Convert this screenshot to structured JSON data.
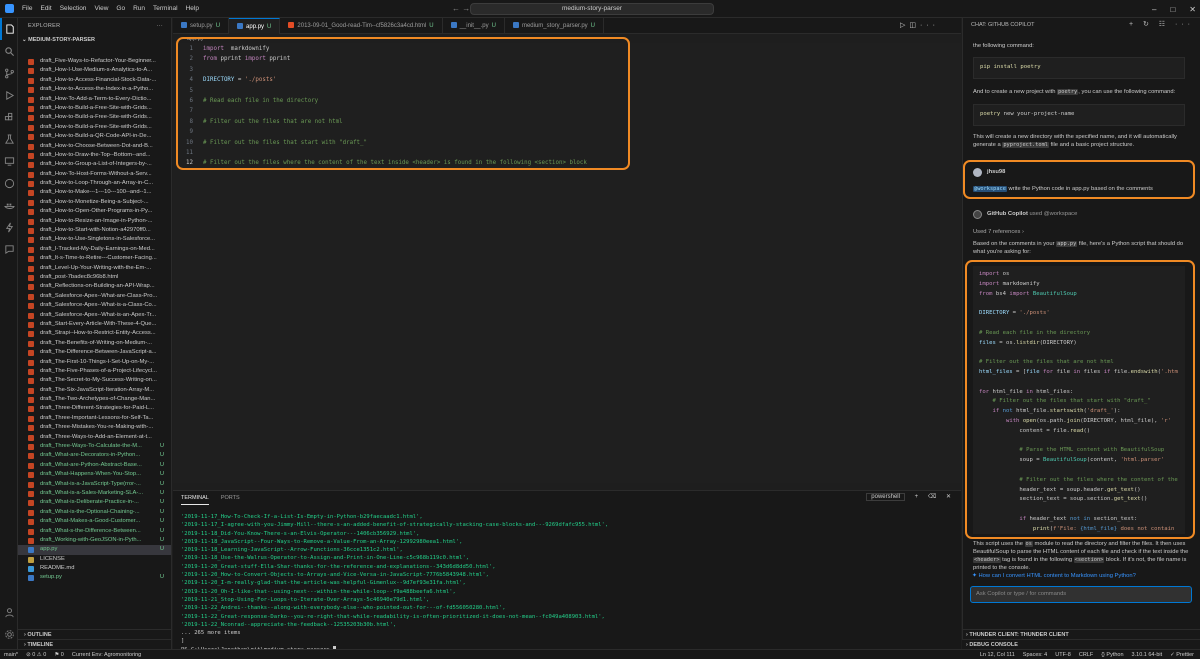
{
  "title_bar": {
    "menus": [
      "File",
      "Edit",
      "Selection",
      "View",
      "Go",
      "Run",
      "Terminal",
      "Help"
    ],
    "search_text": "medium-story-parser",
    "nav_arrows": "← →"
  },
  "explorer": {
    "header": "EXPLORER",
    "project": "MEDIUM-STORY-PARSER",
    "files": [
      {
        "name": "draft_Five-Ways-to-Refactor-Your-Beginner...",
        "status": "",
        "color": "normal"
      },
      {
        "name": "draft_How-I-Use-Medium-s-Analytics-to-A...",
        "status": "",
        "color": "normal"
      },
      {
        "name": "draft_How-to-Access-Financial-Stock-Data-...",
        "status": "",
        "color": "normal"
      },
      {
        "name": "draft_How-to-Access-the-Index-in-a-Pytho...",
        "status": "",
        "color": "normal"
      },
      {
        "name": "draft_How-To-Add-a-Term-to-Every-Dictio...",
        "status": "",
        "color": "normal"
      },
      {
        "name": "draft_How-to-Build-a-Free-Site-with-Grids...",
        "status": "",
        "color": "normal"
      },
      {
        "name": "draft_How-to-Build-a-Free-Site-with-Grids...",
        "status": "",
        "color": "normal"
      },
      {
        "name": "draft_How-to-Build-a-Free-Site-with-Grids...",
        "status": "",
        "color": "normal"
      },
      {
        "name": "draft_How-to-Build-a-QR-Code-API-in-De...",
        "status": "",
        "color": "normal"
      },
      {
        "name": "draft_How-to-Choose-Between-Dot-and-B...",
        "status": "",
        "color": "normal"
      },
      {
        "name": "draft_How-to-Draw-the-Top--Bottom--and...",
        "status": "",
        "color": "normal"
      },
      {
        "name": "draft_How-to-Group-a-List-of-Integers-by-...",
        "status": "",
        "color": "normal"
      },
      {
        "name": "draft_How-To-Host-Forms-Without-a-Serv...",
        "status": "",
        "color": "normal"
      },
      {
        "name": "draft_How-to-Loop-Through-an-Array-in-C...",
        "status": "",
        "color": "normal"
      },
      {
        "name": "draft_How-to-Make---1---10---100--and--1...",
        "status": "",
        "color": "normal"
      },
      {
        "name": "draft_How-to-Monetize-Being-a-Subject-...",
        "status": "",
        "color": "normal"
      },
      {
        "name": "draft_How-to-Open-Other-Programs-in-Py...",
        "status": "",
        "color": "normal"
      },
      {
        "name": "draft_How-to-Resize-an-Image-in-Python-...",
        "status": "",
        "color": "normal"
      },
      {
        "name": "draft_How-to-Start-with-Notion-a42970ff0...",
        "status": "",
        "color": "normal"
      },
      {
        "name": "draft_How-to-Use-Singletons-in-Salesforce...",
        "status": "",
        "color": "normal"
      },
      {
        "name": "draft_I-Tracked-My-Daily-Earnings-on-Med...",
        "status": "",
        "color": "normal"
      },
      {
        "name": "draft_It-s-Time-to-Retire---Customer-Facing...",
        "status": "",
        "color": "normal"
      },
      {
        "name": "draft_Level-Up-Your-Writing-with-the-Em-...",
        "status": "",
        "color": "normal"
      },
      {
        "name": "draft_post-7badec8c96b8.html",
        "status": "",
        "color": "normal"
      },
      {
        "name": "draft_Reflections-on-Building-an-API-Wrap...",
        "status": "",
        "color": "normal"
      },
      {
        "name": "draft_Salesforce-Apex--What-are-Class-Pro...",
        "status": "",
        "color": "normal"
      },
      {
        "name": "draft_Salesforce-Apex--What-is-a-Class-Co...",
        "status": "",
        "color": "normal"
      },
      {
        "name": "draft_Salesforce-Apex--What-is-an-Apex-Tr...",
        "status": "",
        "color": "normal"
      },
      {
        "name": "draft_Start-Every-Article-With-These-4-Que...",
        "status": "",
        "color": "normal"
      },
      {
        "name": "draft_Strapi--How-to-Restrict-Entity-Access...",
        "status": "",
        "color": "normal"
      },
      {
        "name": "draft_The-Benefits-of-Writing-on-Medium-...",
        "status": "",
        "color": "normal"
      },
      {
        "name": "draft_The-Difference-Between-JavaScript-a...",
        "status": "",
        "color": "normal"
      },
      {
        "name": "draft_The-First-10-Things-I-Set-Up-on-My-...",
        "status": "",
        "color": "normal"
      },
      {
        "name": "draft_The-Five-Phases-of-a-Project-Lifecycl...",
        "status": "",
        "color": "normal"
      },
      {
        "name": "draft_The-Secret-to-My-Success-Writing-on...",
        "status": "",
        "color": "normal"
      },
      {
        "name": "draft_The-Six-JavaScript-Iteration-Array-M...",
        "status": "",
        "color": "normal"
      },
      {
        "name": "draft_The-Two-Archetypes-of-Change-Man...",
        "status": "",
        "color": "normal"
      },
      {
        "name": "draft_Three-Different-Strategies-for-Paid-L...",
        "status": "",
        "color": "normal"
      },
      {
        "name": "draft_Three-Important-Lessons-for-Self-Ta...",
        "status": "",
        "color": "normal"
      },
      {
        "name": "draft_Three-Mistakes-You-re-Making-with-...",
        "status": "",
        "color": "normal"
      },
      {
        "name": "draft_Three-Ways-to-Add-an-Element-at-t...",
        "status": "",
        "color": "normal"
      },
      {
        "name": "draft_Three-Ways-To-Calculate-the-M...",
        "status": "U",
        "color": "green"
      },
      {
        "name": "draft_What-are-Decorators-in-Python...",
        "status": "U",
        "color": "green"
      },
      {
        "name": "draft_What-are-Python-Abstract-Base...",
        "status": "U",
        "color": "green"
      },
      {
        "name": "draft_What-Happens-When-You-Stop...",
        "status": "U",
        "color": "green"
      },
      {
        "name": "draft_What-is-a-JavaScript-Type(rror-...",
        "status": "U",
        "color": "green"
      },
      {
        "name": "draft_What-is-a-Sales-Marketing-SLA-...",
        "status": "U",
        "color": "green"
      },
      {
        "name": "draft_What-is-Deliberate-Practice-in-...",
        "status": "U",
        "color": "green"
      },
      {
        "name": "draft_What-is-the-Optional-Chaining-...",
        "status": "U",
        "color": "green"
      },
      {
        "name": "draft_What-Makes-a-Good-Customer...",
        "status": "U",
        "color": "green"
      },
      {
        "name": "draft_What-s-the-Difference-Between...",
        "status": "U",
        "color": "green"
      },
      {
        "name": "draft_Working-with-GeoJSON-in-Pyth...",
        "status": "U",
        "color": "green"
      },
      {
        "name": "app.py",
        "status": "U",
        "color": "green",
        "selected": true,
        "icon": "python"
      },
      {
        "name": "LICENSE",
        "status": "",
        "color": "normal",
        "icon": "license"
      },
      {
        "name": "README.md",
        "status": "",
        "color": "normal",
        "icon": "info"
      },
      {
        "name": "setup.py",
        "status": "U",
        "color": "green",
        "icon": "python"
      }
    ],
    "outline": "OUTLINE",
    "timeline": "TIMELINE"
  },
  "tabs": [
    {
      "label": "setup.py",
      "status": "U",
      "icon": "python",
      "active": false
    },
    {
      "label": "app.py",
      "status": "U",
      "icon": "python",
      "active": true
    },
    {
      "label": "2013-09-01_Good-read-Tim--cf5826c3a4cd.html",
      "status": "U",
      "icon": "html",
      "active": false
    },
    {
      "label": "__init__.py",
      "status": "U",
      "icon": "python",
      "active": false
    },
    {
      "label": "medium_story_parser.py",
      "status": "U",
      "icon": "python",
      "active": false
    }
  ],
  "breadcrumb": "app.py",
  "editor_lines": [
    {
      "n": "1",
      "segs": [
        [
          "kw",
          "import"
        ],
        [
          "",
          "  markdownify"
        ]
      ]
    },
    {
      "n": "2",
      "segs": [
        [
          "kw",
          "from"
        ],
        [
          "",
          " pprint "
        ],
        [
          "kw",
          "import"
        ],
        [
          "",
          " pprint"
        ]
      ]
    },
    {
      "n": "3",
      "segs": []
    },
    {
      "n": "4",
      "segs": [
        [
          "var",
          "DIRECTORY"
        ],
        [
          "",
          " = "
        ],
        [
          "str",
          "'./posts'"
        ]
      ]
    },
    {
      "n": "5",
      "segs": []
    },
    {
      "n": "6",
      "segs": [
        [
          "cm",
          "# Read each file in the directory"
        ]
      ]
    },
    {
      "n": "7",
      "segs": []
    },
    {
      "n": "8",
      "segs": [
        [
          "cm",
          "# Filter out the files that are not html"
        ]
      ]
    },
    {
      "n": "9",
      "segs": []
    },
    {
      "n": "10",
      "segs": [
        [
          "cm",
          "# Filter out the files that start with \"draft_\""
        ]
      ]
    },
    {
      "n": "11",
      "segs": []
    },
    {
      "n": "12",
      "segs": [
        [
          "cm",
          "# Filter out the files where the content of the text inside <header> is found in the following <section> block"
        ]
      ]
    }
  ],
  "terminal": {
    "tabs": [
      "TERMINAL",
      "PORTS"
    ],
    "shell": "powershell",
    "lines": [
      "'2019-11-17_How-To-Check-If-a-List-Is-Empty-in-Python-b29faecaadc1.html',",
      "'2019-11-17_I-agree-with-you-Jimmy-Hill--there-s-an-added-benefit-of-strategically-stacking-case-blocks-and---9269dfafc955.html',",
      "'2019-11-18_Did-You-Know-There-s-an-Elvis-Operator---1406cb356929.html',",
      "'2019-11-18_JavaScript--Four-Ways-to-Remove-a-Value-From-an-Array-12992980eea1.html',",
      "'2019-11-18_Learning-JavaScript--Arrow-Functions-36cce1351c2.html',",
      "'2019-11-18_Use-the-Walrus-Operator-to-Assign-and-Print-in-One-Line-c5c968b119c0.html',",
      "'2019-11-20_Great-stuff-Ella-Shar-thanks-for-the-reference-and-explanations--343d6d8dd50.html',",
      "'2019-11-20_How-to-Convert-Objects-to-Arrays-and-Vice-Versa-in-JavaScript-7776b5843948.html',",
      "'2019-11-20_I-m-really-glad-that-the-article-was-helpful-Gimenlux--9d7ef93e31fa.html',",
      "'2019-11-20_Oh-I-like-that--using-next---within-the-while-loop--f9a488beefa6.html',",
      "'2019-11-21_Stop-Using-For-Loops-to-Iterate-Over-Arrays-5c46940e79d1.html',",
      "'2019-11-22_Andrei--thanks--along-with-everybody-else--who-pointed-out-for---of-fd556050280.html',",
      "'2019-11-22_Great-response-Darko--you-re-right-that-while-readability-is-often-prioritized-it-does-not-mean--fc049a408903.html',",
      "'2019-11-22_Nconrad--appreciate-the-feedback--12535203b30b.html',"
    ],
    "more": "... 265 more items",
    "close": "]",
    "prompt": "PS C:\\Users\\Jonathan\\git\\medium-story-parser> "
  },
  "chat": {
    "header": "CHAT: GITHUB COPILOT",
    "intro_tail": "the following command:",
    "cmd1": "pip install poetry",
    "para_new": [
      "And to create a new project with ",
      "poetry",
      ", you can use the following command:"
    ],
    "cmd2": [
      "poetry",
      " new your-project-name"
    ],
    "para_create": [
      "This will create a new directory with the specified name, and it will automatically generate a ",
      "pyproject.toml",
      " file and a basic project structure."
    ],
    "user_name": "jhsu98",
    "user_mention": "@workspace",
    "user_msg": " write the Python code in app.py based on the comments",
    "bot_name": "GitHub Copilot",
    "bot_used": "used @workspace",
    "refs": "Used 7 references",
    "answer_intro": [
      "Based on the comments in your ",
      "app.py",
      " file, here's a Python script that should do what you're asking for:"
    ],
    "code_lines": [
      [
        [
          "kw",
          "import"
        ],
        [
          "",
          " os"
        ]
      ],
      [
        [
          "kw",
          "import"
        ],
        [
          "",
          " markdownify"
        ]
      ],
      [
        [
          "kw",
          "from"
        ],
        [
          "",
          " bs4 "
        ],
        [
          "kw",
          "import"
        ],
        [
          "",
          " "
        ],
        [
          "cls",
          "BeautifulSoup"
        ]
      ],
      [],
      [
        [
          "var",
          "DIRECTORY"
        ],
        [
          "",
          " = "
        ],
        [
          "str",
          "'./posts'"
        ]
      ],
      [],
      [
        [
          "cm",
          "# Read each file in the directory"
        ]
      ],
      [
        [
          "var",
          "files"
        ],
        [
          "",
          " = os."
        ],
        [
          "fn",
          "listdir"
        ],
        [
          "",
          "(DIRECTORY)"
        ]
      ],
      [],
      [
        [
          "cm",
          "# Filter out the files that are not html"
        ]
      ],
      [
        [
          "var",
          "html_files"
        ],
        [
          "",
          " = ["
        ],
        [
          "var",
          "file"
        ],
        [
          "",
          " "
        ],
        [
          "kw",
          "for"
        ],
        [
          "",
          " file "
        ],
        [
          "kw",
          "in"
        ],
        [
          "",
          " files "
        ],
        [
          "kw",
          "if"
        ],
        [
          "",
          " file."
        ],
        [
          "fn",
          "endswith"
        ],
        [
          "",
          "("
        ],
        [
          "str",
          "'.htm"
        ]
      ],
      [],
      [
        [
          "kw",
          "for"
        ],
        [
          "",
          " html_file "
        ],
        [
          "kw",
          "in"
        ],
        [
          "",
          " html_files:"
        ]
      ],
      [
        [
          "cm",
          "    # Filter out the files that start with \"draft_\""
        ]
      ],
      [
        [
          "",
          "    "
        ],
        [
          "kw",
          "if"
        ],
        [
          "",
          " "
        ],
        [
          "bl",
          "not"
        ],
        [
          "",
          " html_file."
        ],
        [
          "fn",
          "startswith"
        ],
        [
          "",
          "("
        ],
        [
          "str",
          "'draft_'"
        ],
        [
          "",
          "):"
        ]
      ],
      [
        [
          "",
          "        "
        ],
        [
          "kw",
          "with"
        ],
        [
          "",
          " "
        ],
        [
          "fn",
          "open"
        ],
        [
          "",
          "(os.path."
        ],
        [
          "fn",
          "join"
        ],
        [
          "",
          "(DIRECTORY, html_file), "
        ],
        [
          "str",
          "'r'"
        ],
        [
          ")"
        ]
      ],
      [
        [
          "",
          "            content = file."
        ],
        [
          "fn",
          "read"
        ],
        [
          "",
          "()"
        ]
      ],
      [],
      [
        [
          "cm",
          "            # Parse the HTML content with BeautifulSoup"
        ]
      ],
      [
        [
          "",
          "            soup = "
        ],
        [
          "cls",
          "BeautifulSoup"
        ],
        [
          "",
          "(content, "
        ],
        [
          "str",
          "'html.parser'"
        ],
        [
          ")"
        ]
      ],
      [],
      [
        [
          "cm",
          "            # Filter out the files where the content of the"
        ]
      ],
      [
        [
          "",
          "            header_text = soup.header."
        ],
        [
          "fn",
          "get_text"
        ],
        [
          "",
          "()"
        ]
      ],
      [
        [
          "",
          "            section_text = soup.section."
        ],
        [
          "fn",
          "get_text"
        ],
        [
          "",
          "()"
        ]
      ],
      [],
      [
        [
          "",
          "            "
        ],
        [
          "kw",
          "if"
        ],
        [
          "",
          " header_text "
        ],
        [
          "bl",
          "not in"
        ],
        [
          "",
          " section_text:"
        ]
      ],
      [
        [
          "",
          "                "
        ],
        [
          "fn",
          "print"
        ],
        [
          "",
          "("
        ],
        [
          "str",
          "f'File: "
        ],
        [
          "bl",
          "{html_file}"
        ],
        [
          "str",
          " does not contain"
        ]
      ]
    ],
    "answer_outro": [
      "This script uses the ",
      "os",
      " module to read the directory and filter the files. It then uses BeautifulSoup to parse the HTML content of each file and check if the text inside the ",
      "<header>",
      " tag is found in the following ",
      "<section>",
      " block. If it's not, the file name is printed to the console."
    ],
    "suggestion": "How can I convert HTML content to Markdown using Python?",
    "input_placeholder": "Ask Copilot or type / for commands",
    "footer1": "THUNDER CLIENT: THUNDER CLIENT",
    "footer2": "DEBUG CONSOLE"
  },
  "statusbar": {
    "left": [
      "main*",
      "⊘ 0 ⚠ 0",
      "⚑ 0",
      "Current Env: Agromonitoring"
    ],
    "right": [
      "Ln 12, Col 111",
      "Spaces: 4",
      "UTF-8",
      "CRLF",
      "{} Python",
      "3.10.1 64-bit",
      "✓ Prettier"
    ]
  },
  "colors": {
    "accent": "#0078d4",
    "highlight_box": "#f08a24",
    "untracked": "#73c991"
  }
}
